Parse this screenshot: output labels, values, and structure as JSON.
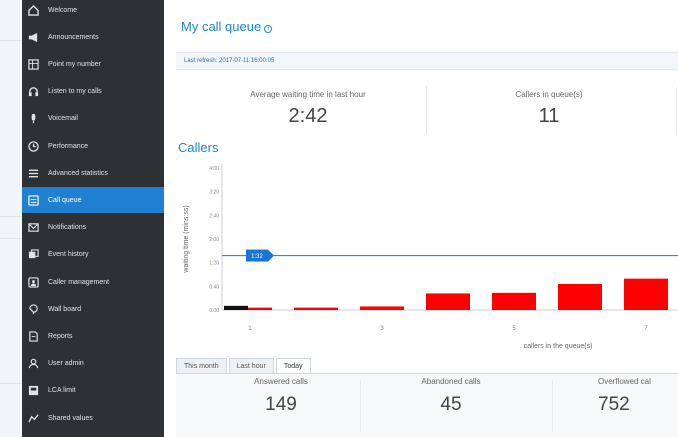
{
  "sidebar": {
    "items": [
      {
        "label": "Welcome",
        "icon": "home-icon",
        "active": false
      },
      {
        "label": "Announcements",
        "icon": "megaphone-icon",
        "active": false
      },
      {
        "label": "Point my number",
        "icon": "grid-icon",
        "active": false
      },
      {
        "label": "Listen to my calls",
        "icon": "headset-icon",
        "active": false
      },
      {
        "label": "Voicemail",
        "icon": "microphone-icon",
        "active": false
      },
      {
        "label": "Performance",
        "icon": "clock-icon",
        "active": false
      },
      {
        "label": "Advanced statistics",
        "icon": "list-icon",
        "active": false
      },
      {
        "label": "Call queue",
        "icon": "phone-queue-icon",
        "active": true
      },
      {
        "label": "Notifications",
        "icon": "envelope-icon",
        "active": false
      },
      {
        "label": "Event history",
        "icon": "history-icon",
        "active": false
      },
      {
        "label": "Caller management",
        "icon": "contacts-icon",
        "active": false
      },
      {
        "label": "Wall board",
        "icon": "monitor-icon",
        "active": false
      },
      {
        "label": "Reports",
        "icon": "report-icon",
        "active": false
      },
      {
        "label": "User admin",
        "icon": "user-icon",
        "active": false
      },
      {
        "label": "LCA limit",
        "icon": "limit-icon",
        "active": false
      },
      {
        "label": "Shared values",
        "icon": "share-icon",
        "active": false
      }
    ]
  },
  "main": {
    "title": "My call queue",
    "info_icon": "i",
    "last_refresh": "Last refresh: 2017-07-11 16:00:05",
    "stats": {
      "avg_wait_label": "Average waiting time in last hour",
      "avg_wait_value": "2:42",
      "callers_label": "Callers in queue(s)",
      "callers_value": "11"
    },
    "callers_title": "Callers",
    "tabs": [
      {
        "label": "This month",
        "active": false
      },
      {
        "label": "Last hour",
        "active": false
      },
      {
        "label": "Today",
        "active": true
      }
    ],
    "bottom": {
      "answered_label": "Answered calls",
      "answered_value": "149",
      "abandoned_label": "Abandoned calls",
      "abandoned_value": "45",
      "overflowed_label": "Overflowed cal",
      "overflowed_value": "752"
    }
  },
  "chart_data": {
    "type": "bar",
    "ylabel": "waiting time (mins:ss)",
    "xlabel": "callers in the queue(s)",
    "y_ticks": [
      "0.00",
      "0:40",
      "1:20",
      "2:00",
      "2:40",
      "3:20",
      "4:00"
    ],
    "ylim_seconds": [
      0,
      240
    ],
    "x_ticks": [
      {
        "label": "1",
        "at_bar": 0
      },
      {
        "label": "3",
        "at_bar": 2
      },
      {
        "label": "5",
        "at_bar": 4
      },
      {
        "label": "7",
        "at_bar": 6
      }
    ],
    "bars_seconds": [
      4,
      4,
      6,
      28,
      29,
      44,
      53
    ],
    "bar_color": "#ff0000",
    "marker": {
      "label": "1:32",
      "value_seconds": 92,
      "color": "#1976d2"
    },
    "first_bar_marker_color": "#111111"
  }
}
